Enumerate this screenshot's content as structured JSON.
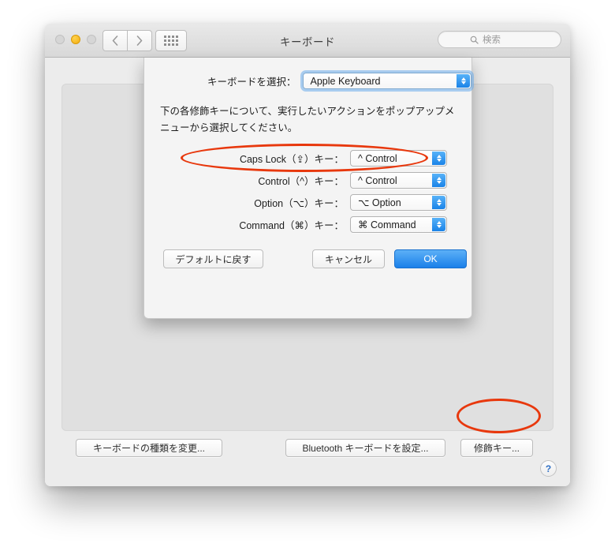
{
  "window": {
    "title": "キーボード",
    "traffic_lights": [
      "close-button",
      "minimize-button",
      "zoom-button"
    ],
    "nav": {
      "back": "‹",
      "forward": "›"
    },
    "show_all_icon": "grid-icon",
    "search": {
      "placeholder": "検索",
      "value": "",
      "icon": "search-icon"
    },
    "help_label": "?"
  },
  "pane": {
    "buttons": {
      "change_keyboard_type": "キーボードの種類を変更...",
      "setup_bluetooth_keyboard": "Bluetooth キーボードを設定...",
      "modifier_keys": "修飾キー..."
    }
  },
  "sheet": {
    "select_label": "キーボードを選択：",
    "selected_keyboard": "Apple Keyboard",
    "description": "下の各修飾キーについて、実行したいアクションをポップアップメニューから選択してください。",
    "modifiers": [
      {
        "label": "Caps Lock（⇪）キー：",
        "value": "^ Control"
      },
      {
        "label": "Control（^）キー：",
        "value": "^ Control"
      },
      {
        "label": "Option（⌥）キー：",
        "value": "⌥ Option"
      },
      {
        "label": "Command（⌘）キー：",
        "value": "⌘ Command"
      }
    ],
    "buttons": {
      "restore_defaults": "デフォルトに戻す",
      "cancel": "キャンセル",
      "ok": "OK"
    }
  },
  "annotations": {
    "color": "#e8380d",
    "items": [
      "caps-lock-row-highlight",
      "modifier-keys-button-highlight"
    ]
  }
}
